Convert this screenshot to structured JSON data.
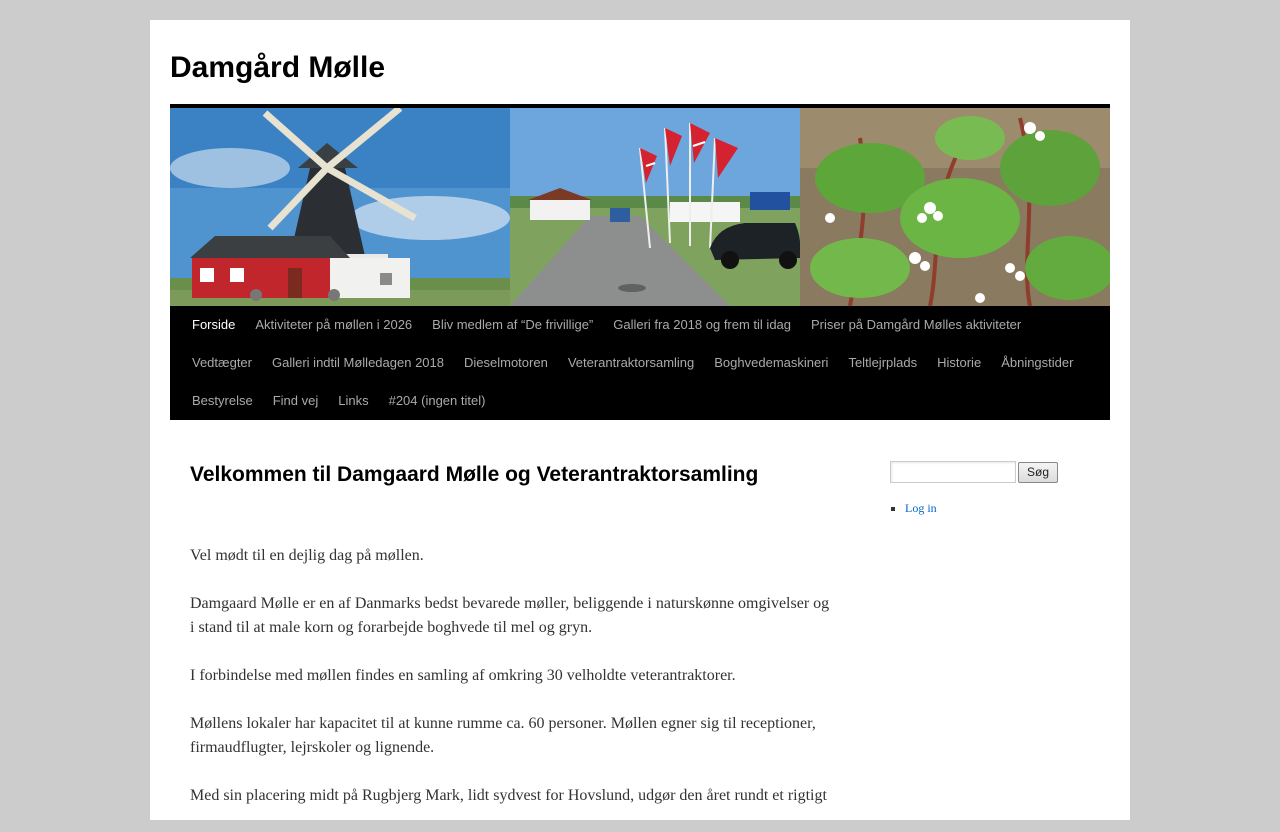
{
  "site": {
    "title": "Damgård Mølle"
  },
  "nav": {
    "items": [
      "Forside",
      "Aktiviteter på møllen i 2026",
      "Bliv medlem af “De frivillige”",
      "Galleri fra 2018 og frem til idag",
      "Priser på Damgård Mølles aktiviteter",
      "Vedtægter",
      "Galleri indtil Mølledagen 2018",
      "Dieselmotoren",
      "Veterantraktorsamling",
      "Boghvedemaskineri",
      "Teltlejrplads",
      "Historie",
      "Åbningstider",
      "Bestyrelse",
      "Find vej",
      "Links",
      "#204 (ingen titel)"
    ],
    "current": "Forside"
  },
  "post": {
    "title": "Velkommen til Damgaard Mølle og Veterantraktorsamling",
    "paragraphs": [
      "Vel mødt til en dejlig dag på møllen.",
      "Damgaard Mølle er en af Danmarks bedst bevarede møller, beliggende i naturskønne omgivelser og i stand til at male korn og forarbejde boghvede til mel og gryn.",
      "I forbindelse med møllen findes en samling af omkring 30 velholdte veterantraktorer.",
      "Møllens lokaler har kapacitet til at kunne rumme ca. 60 personer. Møllen egner sig til receptioner, firmaudflugter, lejrskoler og lignende.",
      "Med sin placering midt på Rugbjerg Mark, lidt sydvest for Hovslund, udgør den året rundt et rigtigt"
    ]
  },
  "sidebar": {
    "search_button": "Søg",
    "search_value": "",
    "meta_links": [
      "Log in"
    ]
  },
  "colors": {
    "page_bg": "#cccccc",
    "nav_bg": "#000000",
    "nav_text": "#aaaaaa",
    "nav_current": "#ffffff",
    "link": "#0066cc"
  }
}
